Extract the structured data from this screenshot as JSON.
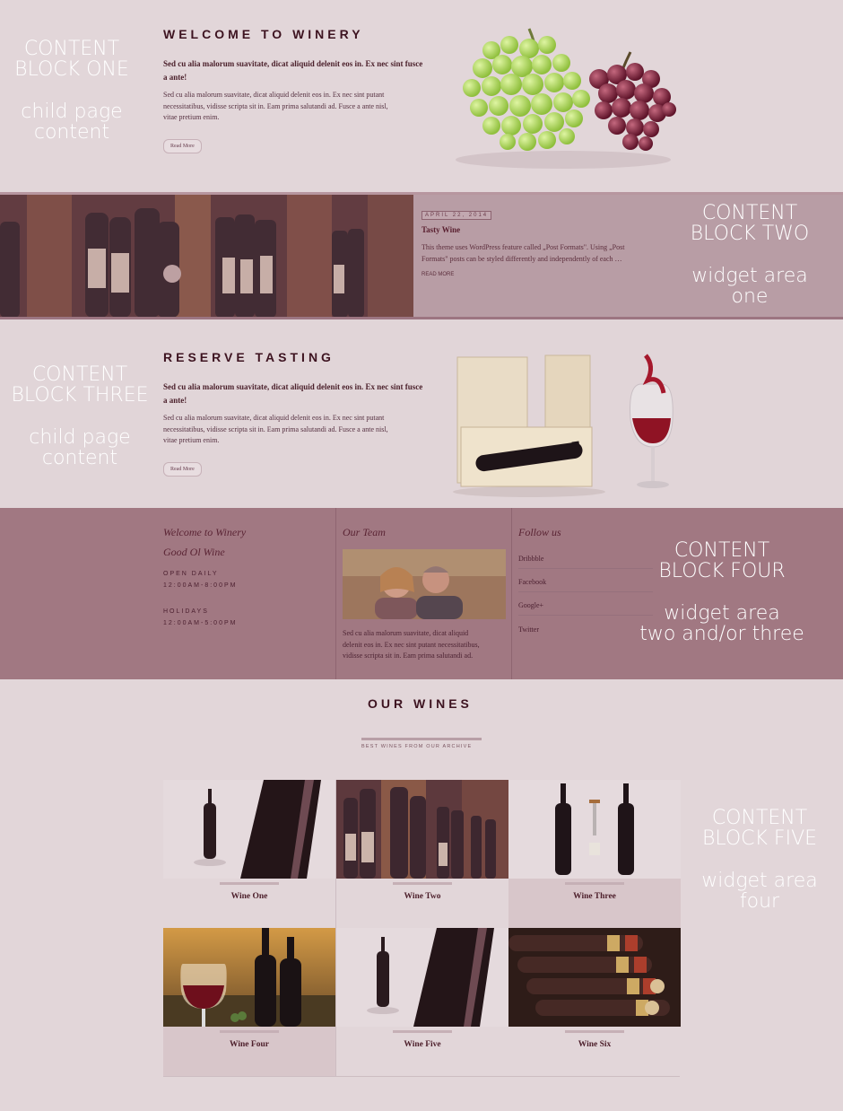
{
  "block1": {
    "label_line1": "CONTENT",
    "label_line2": "BLOCK ONE",
    "label_line3": "child page",
    "label_line4": "content",
    "heading": "WELCOME TO WINERY",
    "intro_line1": "Sed cu alia malorum suavitate, dicat aliquid delenit eos in. Ex nec sint fusce",
    "intro_line2": "a ante!",
    "body_line1": "Sed cu alia malorum suavitate, dicat aliquid delenit eos in. Ex nec sint putant",
    "body_line2": "necessitatibus, vidisse scripta sit in. Eam prima salutandi ad. Fusce a ante nisl,",
    "body_line3": "vitae pretium enim.",
    "button": "Read More",
    "image_icon": "grapes-image"
  },
  "block2": {
    "label_line1": "CONTENT",
    "label_line2": "BLOCK TWO",
    "label_line3": "widget area",
    "label_line4": "one",
    "date": "APRIL 22, 2014",
    "post_title": "Tasty Wine",
    "excerpt_line1": "This theme uses WordPress feature called „Post Formats\". Using „Post",
    "excerpt_line2": "Formats\" posts can be styled differently and independently of each …",
    "read_more": "READ MORE",
    "image_icon": "wine-shelf-image"
  },
  "block3": {
    "label_line1": "CONTENT",
    "label_line2": "BLOCK THREE",
    "label_line3": "child page",
    "label_line4": "content",
    "heading": "RESERVE TASTING",
    "intro_line1": "Sed cu alia malorum suavitate, dicat aliquid delenit eos in. Ex nec sint fusce",
    "intro_line2": "a ante!",
    "body_line1": "Sed cu alia malorum suavitate, dicat aliquid delenit eos in. Ex nec sint putant",
    "body_line2": "necessitatibus, vidisse scripta sit in. Eam prima salutandi ad. Fusce a ante nisl,",
    "body_line3": "vitae pretium enim.",
    "button": "Read More",
    "image_icon": "wine-box-and-glass-image"
  },
  "block4": {
    "label_line1": "CONTENT",
    "label_line2": "BLOCK FOUR",
    "label_line3": "widget area",
    "label_line4": "two and/or three",
    "col1_title": "Welcome to Winery",
    "col1_subtitle": "Good Ol Wine",
    "hours1_label": "OPEN DAILY",
    "hours1_value": "12:00AM-8:00PM",
    "hours2_label": "HOLIDAYS",
    "hours2_value": "12:00AM-5:00PM",
    "col2_title": "Our Team",
    "team_text_line1": "Sed cu alia malorum suavitate, dicat aliquid",
    "team_text_line2": "delenit eos in. Ex nec sint putant necessitatibus,",
    "team_text_line3": "vidisse scripta sit in. Eam prima salutandi ad.",
    "col3_title": "Follow us",
    "links": [
      "Dribbble",
      "Facebook",
      "Google+",
      "Twitter"
    ],
    "image_icon": "team-photo-image"
  },
  "block5": {
    "label_line1": "CONTENT",
    "label_line2": "BLOCK FIVE",
    "label_line3": "widget area",
    "label_line4": "four",
    "heading": "OUR WINES",
    "subheading": "BEST WINES FROM OUR ARCHIVE",
    "wines": [
      "Wine One",
      "Wine Two",
      "Wine Three",
      "Wine Four",
      "Wine Five",
      "Wine Six"
    ]
  }
}
